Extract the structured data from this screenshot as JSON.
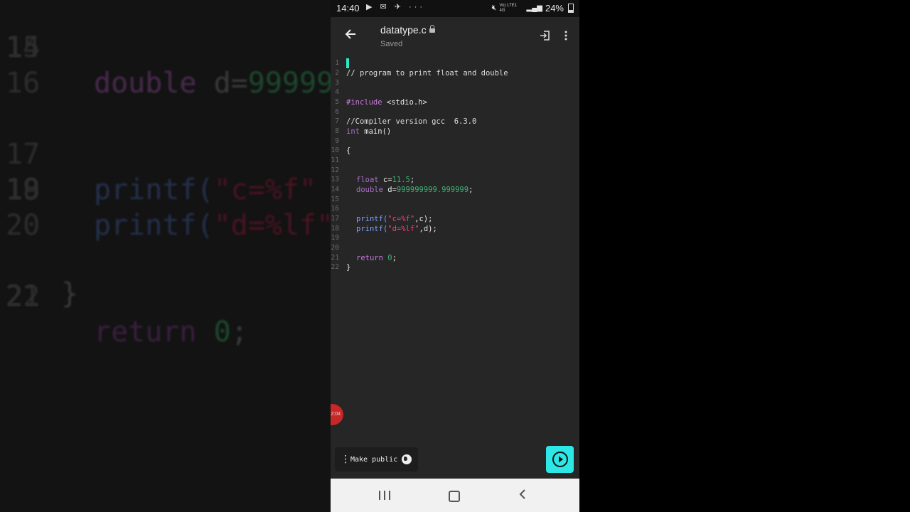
{
  "backdrop": {
    "lines": [
      {
        "num": "14",
        "code_kw": "double",
        "code_rest": " d=",
        "code_num": "99999"
      },
      {
        "num": "15"
      },
      {
        "num": "16"
      },
      {
        "num": "17",
        "code_fn": "printf(",
        "code_str": "\"c=%f\""
      },
      {
        "num": "18",
        "code_fn": "printf(",
        "code_str": "\"d=%lf\""
      },
      {
        "num": "19"
      },
      {
        "num": "20"
      },
      {
        "num": "21",
        "code_kw": "return",
        "code_rest": " ",
        "code_num": "0",
        "code_tail": ";"
      },
      {
        "num": "22"
      }
    ],
    "closing_brace": "}"
  },
  "statusbar": {
    "time": "14:40",
    "left_icons": "▶ ✉ ✈ ···",
    "network": "Vo) LTE1 4G",
    "battery": "24%"
  },
  "appbar": {
    "filename": "datatype.c",
    "status": "Saved"
  },
  "editor": {
    "line_numbers": [
      "1",
      "2",
      "3",
      "4",
      "5",
      "6",
      "7",
      "8",
      "9",
      "10",
      "11",
      "12",
      "13",
      "14",
      "15",
      "16",
      "17",
      "18",
      "19",
      "20",
      "21",
      "22"
    ],
    "comment1": "// program to print float and double",
    "include_kw": "#include",
    "include_hdr": " <stdio.h>",
    "comment2": "//Compiler version gcc  6.3.0",
    "int_kw": "int",
    "main_sig": " main()",
    "open_brace": "{",
    "float_kw": "float",
    "float_var": " c=",
    "float_val": "11.5",
    "semi": ";",
    "double_kw": "double",
    "double_var": " d=",
    "double_val": "999999999.999999",
    "printf": "printf(",
    "fmt_c": "\"c=%f\"",
    "arg_c": ",c);",
    "fmt_d": "\"d=%lf\"",
    "arg_d": ",d);",
    "return_kw": "return",
    "return_val": "0",
    "close_brace": "}"
  },
  "floating": {
    "red_badge": "2:04"
  },
  "bottombar": {
    "make_public": "Make public"
  },
  "icons": {
    "back": "arrow-left",
    "lock": "lock",
    "login": "login",
    "more": "more-vertical",
    "globe": "globe",
    "run": "play-circle"
  },
  "colors": {
    "run_button": "#2de6e6",
    "cursor": "#2ee6c6",
    "keyword": "#c678dd",
    "string": "#f0407a",
    "number": "#3cb371",
    "function": "#7fa2ff"
  }
}
